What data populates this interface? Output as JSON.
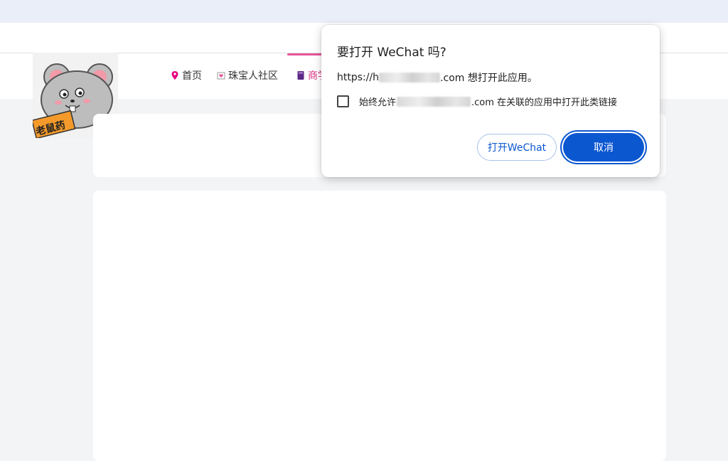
{
  "dialog": {
    "title": "要打开 WeChat 吗?",
    "message_prefix": "https://h",
    "message_suffix": ".com 想打开此应用。",
    "checkbox_prefix": "始终允许",
    "checkbox_suffix": ".com 在关联的应用中打开此类链接",
    "checkbox_checked": false,
    "open_button": "打开WeChat",
    "cancel_button": "取消",
    "accent_color": "#0b57d0"
  },
  "site": {
    "logo_text": "老鼠药",
    "nav": [
      {
        "label": "首页",
        "icon": "location-pin-icon"
      },
      {
        "label": "珠宝人社区",
        "icon": "heart-envelope-icon"
      },
      {
        "label": "商学",
        "icon": "book-icon"
      }
    ],
    "accent_color": "#e8559a"
  }
}
